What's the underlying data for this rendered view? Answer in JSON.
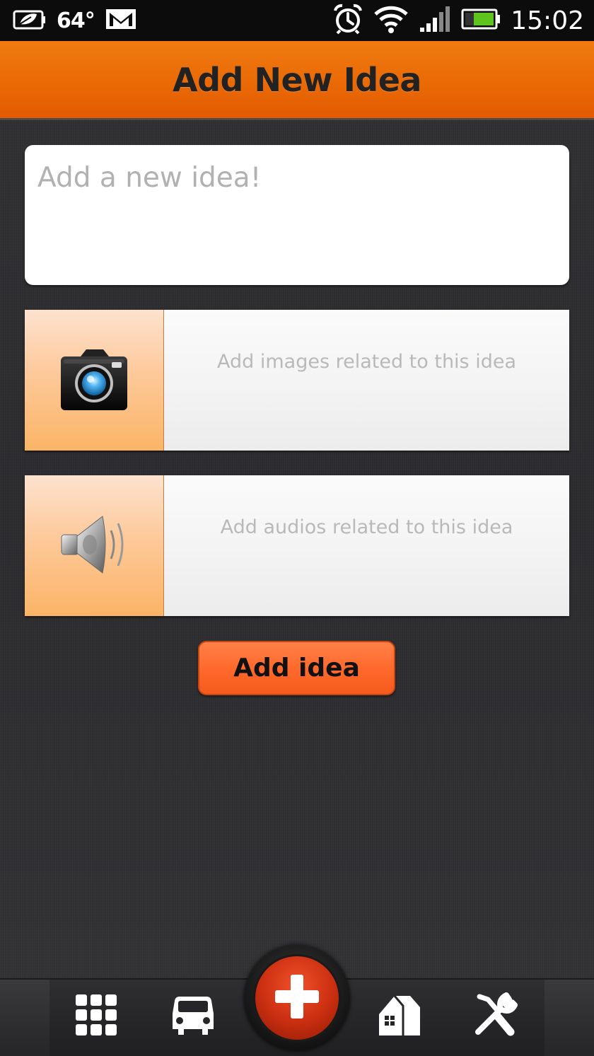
{
  "status_bar": {
    "temperature": "64°",
    "time": "15:02",
    "icons": [
      "eco-battery-icon",
      "gmail-icon",
      "alarm-icon",
      "wifi-icon",
      "signal-icon",
      "battery-icon"
    ]
  },
  "header": {
    "title": "Add New Idea"
  },
  "idea_input": {
    "placeholder": "Add a new idea!",
    "value": ""
  },
  "media": {
    "images": {
      "label": "Add images related to this idea",
      "icon": "camera-icon"
    },
    "audios": {
      "label": "Add audios related to this idea",
      "icon": "speaker-icon"
    }
  },
  "actions": {
    "add_label": "Add idea"
  },
  "bottom_nav": {
    "items": [
      {
        "icon": "grid-icon"
      },
      {
        "icon": "car-icon"
      },
      {
        "icon": "plus-icon",
        "active": true
      },
      {
        "icon": "home-icon"
      },
      {
        "icon": "tools-icon"
      }
    ]
  },
  "colors": {
    "header_orange": "#ea6a06",
    "button_orange": "#ff6a2c",
    "fab_red": "#c92e10",
    "background": "#2e2e31"
  }
}
